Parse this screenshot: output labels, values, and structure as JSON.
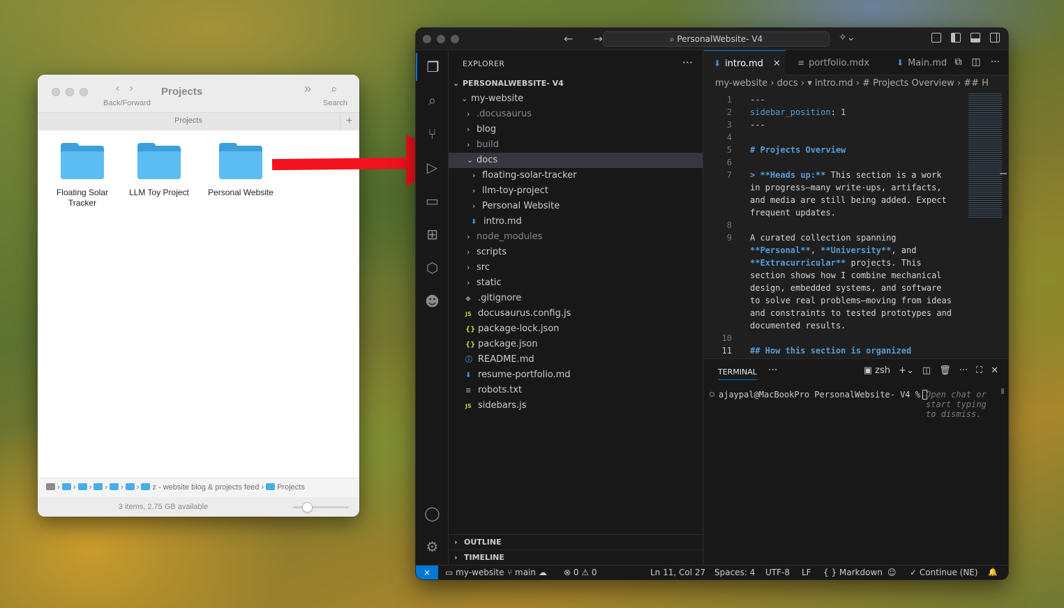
{
  "finder": {
    "title": "Projects",
    "nav_arrows": "‹›",
    "nav_label": "Back/Forward",
    "more_icon": "»",
    "search_label": "Search",
    "tab_label": "Projects",
    "tab_add": "+",
    "items": [
      {
        "label": "Floating Solar Tracker"
      },
      {
        "label": "LLM Toy Project"
      },
      {
        "label": "Personal Website"
      }
    ],
    "path": {
      "segment_website": "z - website blog & projects feed",
      "segment_projects": "Projects"
    },
    "status": "3 items, 2.75 GB available",
    "zoom_slider_value": 0.25,
    "folder_color": "#5bbdf2"
  },
  "annotation": {
    "arrow_color": "#f2121e"
  },
  "vscode": {
    "nav_arrows": "← →",
    "command_center": "⌕ PersonalWebsite- V4",
    "copilot_icon": "✧⌄",
    "activity_icons": [
      "files-icon",
      "search-icon",
      "source-control-icon",
      "run-debug-icon",
      "remote-explorer-icon",
      "extensions-icon",
      "containers-icon",
      "alien-icon",
      "accounts-icon",
      "settings-gear-icon"
    ],
    "explorer": {
      "title": "EXPLORER",
      "more": "···",
      "root": "PERSONALWEBSITE- V4",
      "tree": {
        "my_website": "my-website",
        "docusaurus": ".docusaurus",
        "blog": "blog",
        "build": "build",
        "docs": "docs",
        "floating_solar": "floating-solar-tracker",
        "llm_toy": "llm-toy-project",
        "personal_website": "Personal Website",
        "intro": "intro.md",
        "node_modules": "node_modules",
        "scripts": "scripts",
        "src": "src",
        "static": "static",
        "gitignore": ".gitignore",
        "docusaurus_config": "docusaurus.config.js",
        "package_lock": "package-lock.json",
        "package": "package.json",
        "readme": "README.md",
        "resume": "resume-portfolio.md",
        "robots": "robots.txt",
        "sidebars": "sidebars.js"
      },
      "outline": "OUTLINE",
      "timeline": "TIMELINE"
    },
    "tabs": {
      "intro": "intro.md",
      "portfolio": "portfolio.mdx",
      "main": "Main.md",
      "close": "✕"
    },
    "breadcrumbs": "my-website › docs › ▾ intro.md › # Projects Overview › ## H",
    "code": {
      "l1": "---",
      "l2_key": "sidebar_position",
      "l2_sep": ": ",
      "l2_val": "1",
      "l3": "---",
      "l5": "# Projects Overview",
      "l7a_q": "> ",
      "l7a_bold": "**Heads up:**",
      "l7a_rest": " This section is a work",
      "l7b": "in progress—many write-ups, artifacts,",
      "l7c": "and media are still being added. Expect",
      "l7d": "frequent updates.",
      "l9a": "A curated collection spanning",
      "l9b_b1": "**Personal**",
      "l9b_sep": ", ",
      "l9b_b2": "**University**",
      "l9b_rest": ", and",
      "l9c_b": "**Extracurricular**",
      "l9c_rest": " projects. This",
      "l9d": "section shows how I combine mechanical",
      "l9e": "design, embedded systems, and software",
      "l9f": "to solve real problems—moving from ideas",
      "l9g": "and constraints to tested prototypes and",
      "l9h": "documented results.",
      "l11": "## How this section is organized",
      "line_numbers": [
        "1",
        "2",
        "3",
        "4",
        "5",
        "6",
        "7",
        "8",
        "9",
        "10",
        "11"
      ]
    },
    "panel": {
      "tab": "TERMINAL",
      "more": "···",
      "shell": "zsh",
      "prompt": "ajaypal@MacBookPro PersonalWebsite- V4 %",
      "hint": "Open chat or start typing to dismiss."
    },
    "status": {
      "remote": "⨯",
      "folder": "my-website",
      "branch": "main",
      "problems": "⊗ 0 ⚠ 0",
      "position": "Ln 11, Col 27",
      "spaces": "Spaces: 4",
      "encoding": "UTF-8",
      "eol": "LF",
      "language": "{ } Markdown",
      "continue": "✓ Continue (NE)",
      "bell": "🔔"
    },
    "accent_color": "#0078d4"
  }
}
